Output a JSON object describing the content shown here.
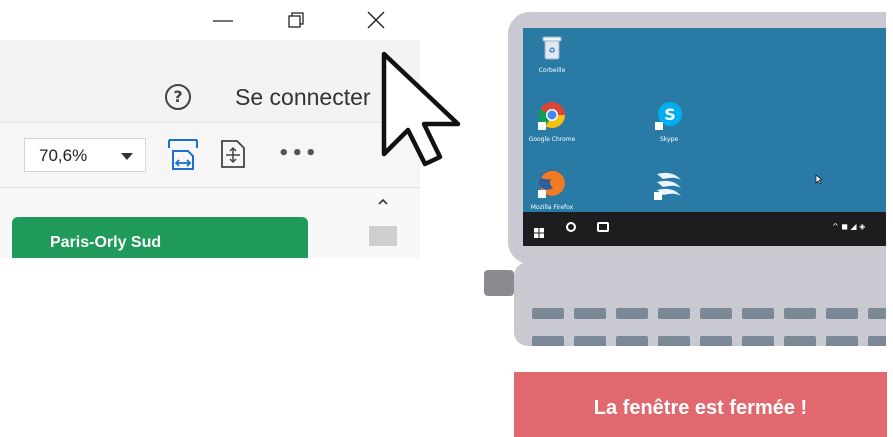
{
  "window": {
    "controls": {
      "minimize_icon": "minimize-icon",
      "maximize_icon": "restore-icon",
      "close_icon": "close-icon"
    },
    "signin": {
      "help_glyph": "?",
      "label": "Se connecter"
    },
    "toolbar": {
      "zoom_value": "70,6%",
      "fit_width_icon": "fit-width-icon",
      "fit_page_icon": "fit-page-icon",
      "more_glyph": "•••"
    },
    "document": {
      "station_name": "Paris-Orly Sud",
      "station_color": "#1f9a5a"
    }
  },
  "laptop": {
    "desktop": {
      "background": "#2a7aa6",
      "icons": [
        {
          "label": "Corbeille",
          "icon": "recycle-bin-icon"
        },
        {
          "label": "Google Chrome",
          "icon": "chrome-icon"
        },
        {
          "label": "Skype",
          "icon": "skype-icon"
        },
        {
          "label": "Mozilla Firefox",
          "icon": "firefox-icon"
        },
        {
          "label": "",
          "icon": "openoffice-icon"
        }
      ]
    },
    "taskbar": {
      "tray": "^ ◼ ◢ ◈"
    }
  },
  "banner": {
    "message": "La fenêtre est fermée !",
    "color": "#e0686e"
  }
}
